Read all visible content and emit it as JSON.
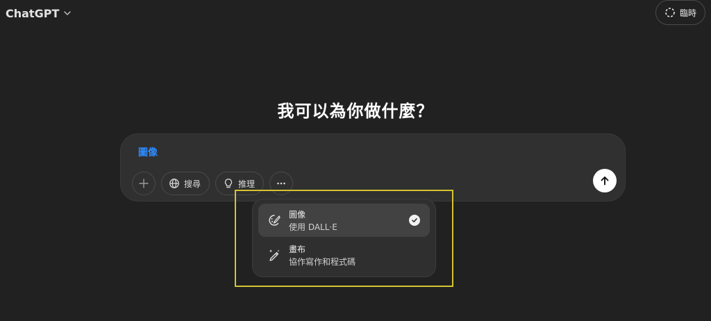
{
  "header": {
    "model_name": "ChatGPT",
    "temporary_label": "臨時"
  },
  "main": {
    "title": "我可以為你做什麼？"
  },
  "composer": {
    "tag": "圖像",
    "tools": {
      "search_label": "搜尋",
      "reason_label": "推理"
    }
  },
  "menu": {
    "items": [
      {
        "label": "圖像",
        "sub": "使用 DALL·E",
        "icon": "image-brush-icon",
        "selected": true
      },
      {
        "label": "畫布",
        "sub": "協作寫作和程式碼",
        "icon": "canvas-pen-icon",
        "selected": false
      }
    ]
  },
  "colors": {
    "background": "#212121",
    "composer": "#303030",
    "tag_blue": "#2f8bff",
    "highlight": "#d6c431"
  }
}
